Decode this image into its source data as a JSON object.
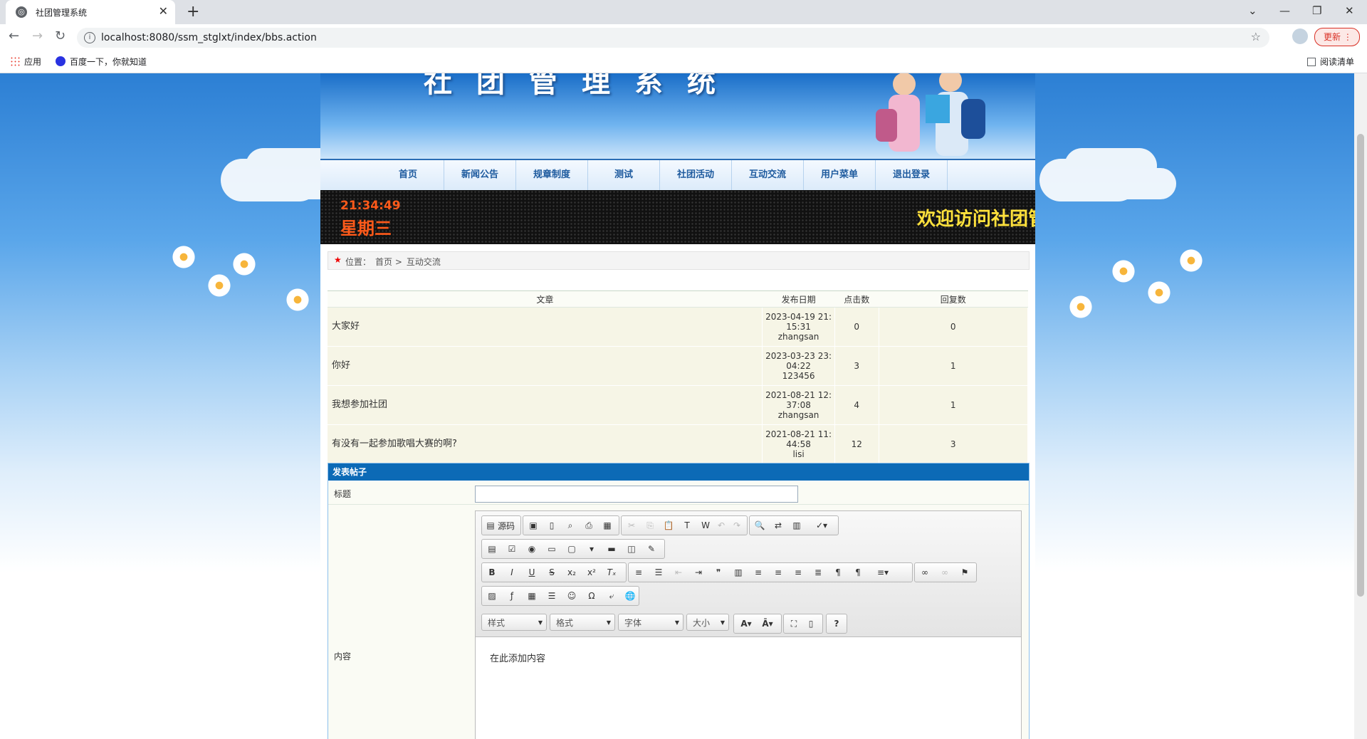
{
  "browser": {
    "tab_title": "社团管理系统",
    "url": "localhost:8080/ssm_stglxt/index/bbs.action",
    "update_label": "更新",
    "bookmarks": [
      "应用",
      "百度一下，你就知道"
    ],
    "reading_list": "阅读清单"
  },
  "site": {
    "title": "社团管理系统",
    "nav": [
      "首页",
      "新闻公告",
      "规章制度",
      "测试",
      "社团活动",
      "互动交流",
      "用户菜单",
      "退出登录"
    ],
    "clock_time": "21:34:49",
    "clock_weekday": "星期三",
    "marquee": "欢迎访问社团管"
  },
  "breadcrumb": {
    "prefix": "位置：",
    "home": "首页 >",
    "current": "互动交流"
  },
  "posts": {
    "headers": [
      "文章",
      "发布日期",
      "点击数",
      "回复数"
    ],
    "rows": [
      {
        "title": "大家好",
        "date1": "2023-04-19 21:",
        "date2": "15:31",
        "author": "zhangsan",
        "clicks": "0",
        "replies": "0"
      },
      {
        "title": "你好",
        "date1": "2023-03-23 23:",
        "date2": "04:22",
        "author": "123456",
        "clicks": "3",
        "replies": "1"
      },
      {
        "title": "我想参加社团",
        "date1": "2021-08-21 12:",
        "date2": "37:08",
        "author": "zhangsan",
        "clicks": "4",
        "replies": "1"
      },
      {
        "title": "有没有一起参加歌唱大赛的啊?",
        "date1": "2021-08-21 11:",
        "date2": "44:58",
        "author": "lisi",
        "clicks": "12",
        "replies": "3"
      }
    ]
  },
  "form": {
    "header": "发表帖子",
    "title_label": "标题",
    "content_label": "内容",
    "source_label": "源码",
    "combos": [
      "样式",
      "格式",
      "字体",
      "大小"
    ],
    "placeholder_content": "在此添加内容"
  }
}
